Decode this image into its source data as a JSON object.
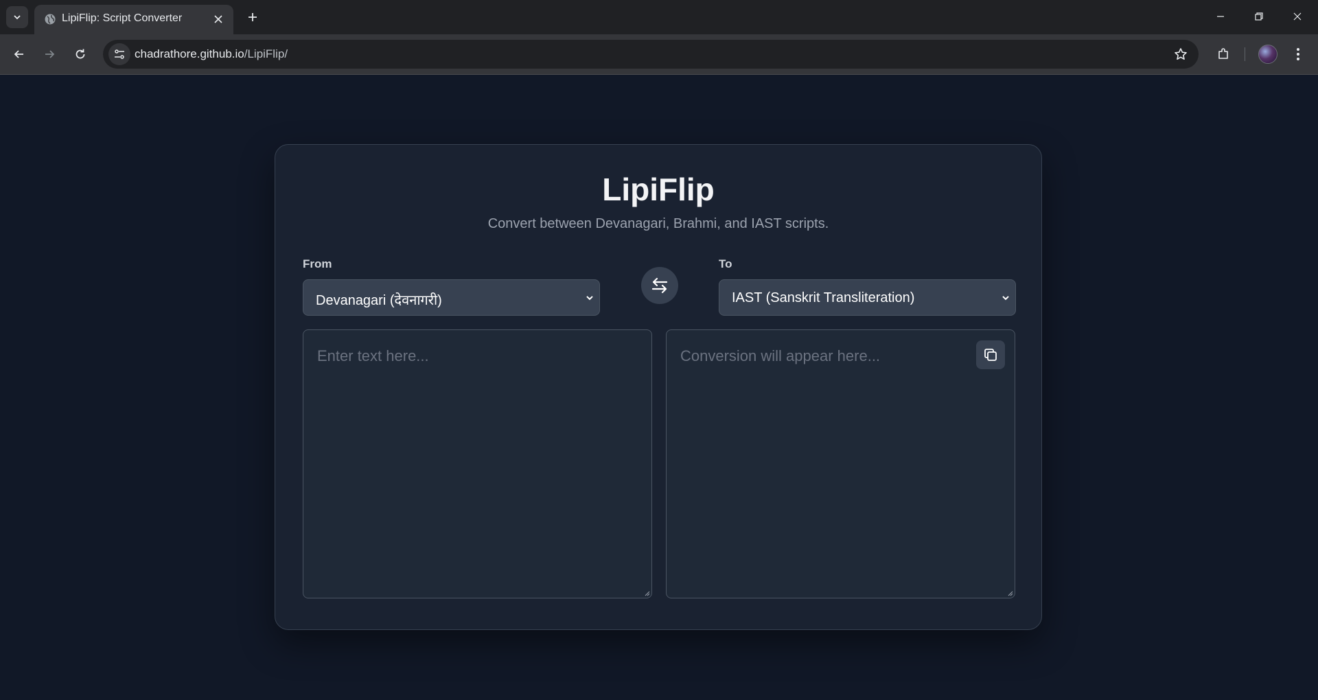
{
  "browser": {
    "tab_title": "LipiFlip: Script Converter",
    "url_host": "chadrathore.github.io",
    "url_path": "/LipiFlip/"
  },
  "app": {
    "title": "LipiFlip",
    "subtitle": "Convert between Devanagari, Brahmi, and IAST scripts."
  },
  "from": {
    "label": "From",
    "selected": "Devanagari (देवनागरी)"
  },
  "to": {
    "label": "To",
    "selected": "IAST (Sanskrit Transliteration)"
  },
  "input": {
    "placeholder": "Enter text here..."
  },
  "output": {
    "placeholder": "Conversion will appear here..."
  },
  "colors": {
    "page_bg": "#111827",
    "card_bg": "#1a2231",
    "control_bg": "#374151"
  }
}
